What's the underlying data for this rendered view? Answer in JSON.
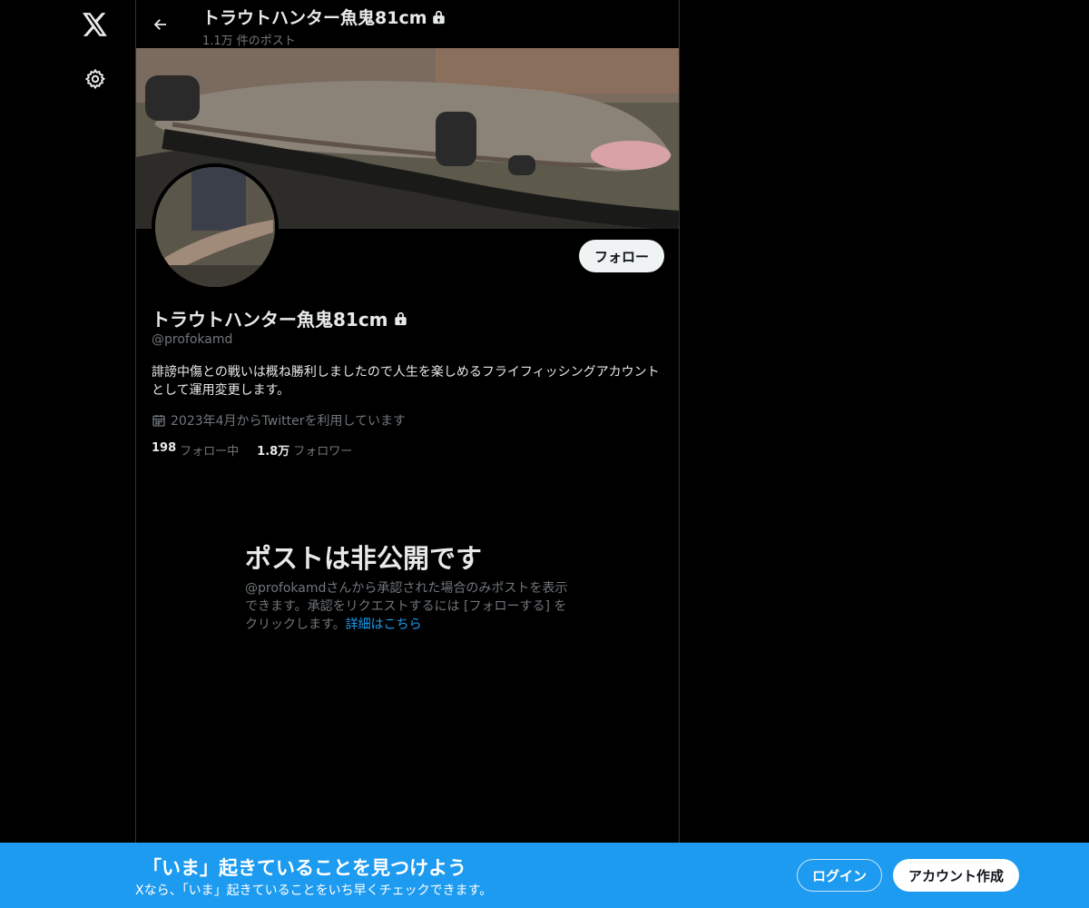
{
  "sidebar": {
    "logo_icon": "x-logo-icon",
    "settings_icon": "gear-icon"
  },
  "header": {
    "back_icon": "arrow-left-icon",
    "title": "トラウトハンター魚鬼81cm",
    "post_count": "1.1万 件のポスト",
    "lock_icon": "lock-icon"
  },
  "profile": {
    "follow_label": "フォロー",
    "name": "トラウトハンター魚鬼81cm",
    "handle": "@profokamd",
    "bio": "誹謗中傷との戦いは概ね勝利しましたので人生を楽しめるフライフィッシングアカウントとして運用変更します。",
    "joined": "2023年4月からTwitterを利用しています",
    "following_count": "198",
    "following_label": "フォロー中",
    "followers_count": "1.8万",
    "followers_label": "フォロワー"
  },
  "private_notice": {
    "title": "ポストは非公開です",
    "description": "@profokamdさんから承認された場合のみポストを表示できます。承認をリクエストするには [フォローする] をクリックします。",
    "link": "詳細はこちら"
  },
  "bottom_bar": {
    "title": "「いま」起きていることを見つけよう",
    "subtitle": "Xなら、「いま」起きていることをいち早くチェックできます。",
    "login_label": "ログイン",
    "signup_label": "アカウント作成"
  },
  "colors": {
    "background": "#000000",
    "accent": "#1d9bf0",
    "text_primary": "#e7e9ea",
    "text_secondary": "#71767b"
  }
}
